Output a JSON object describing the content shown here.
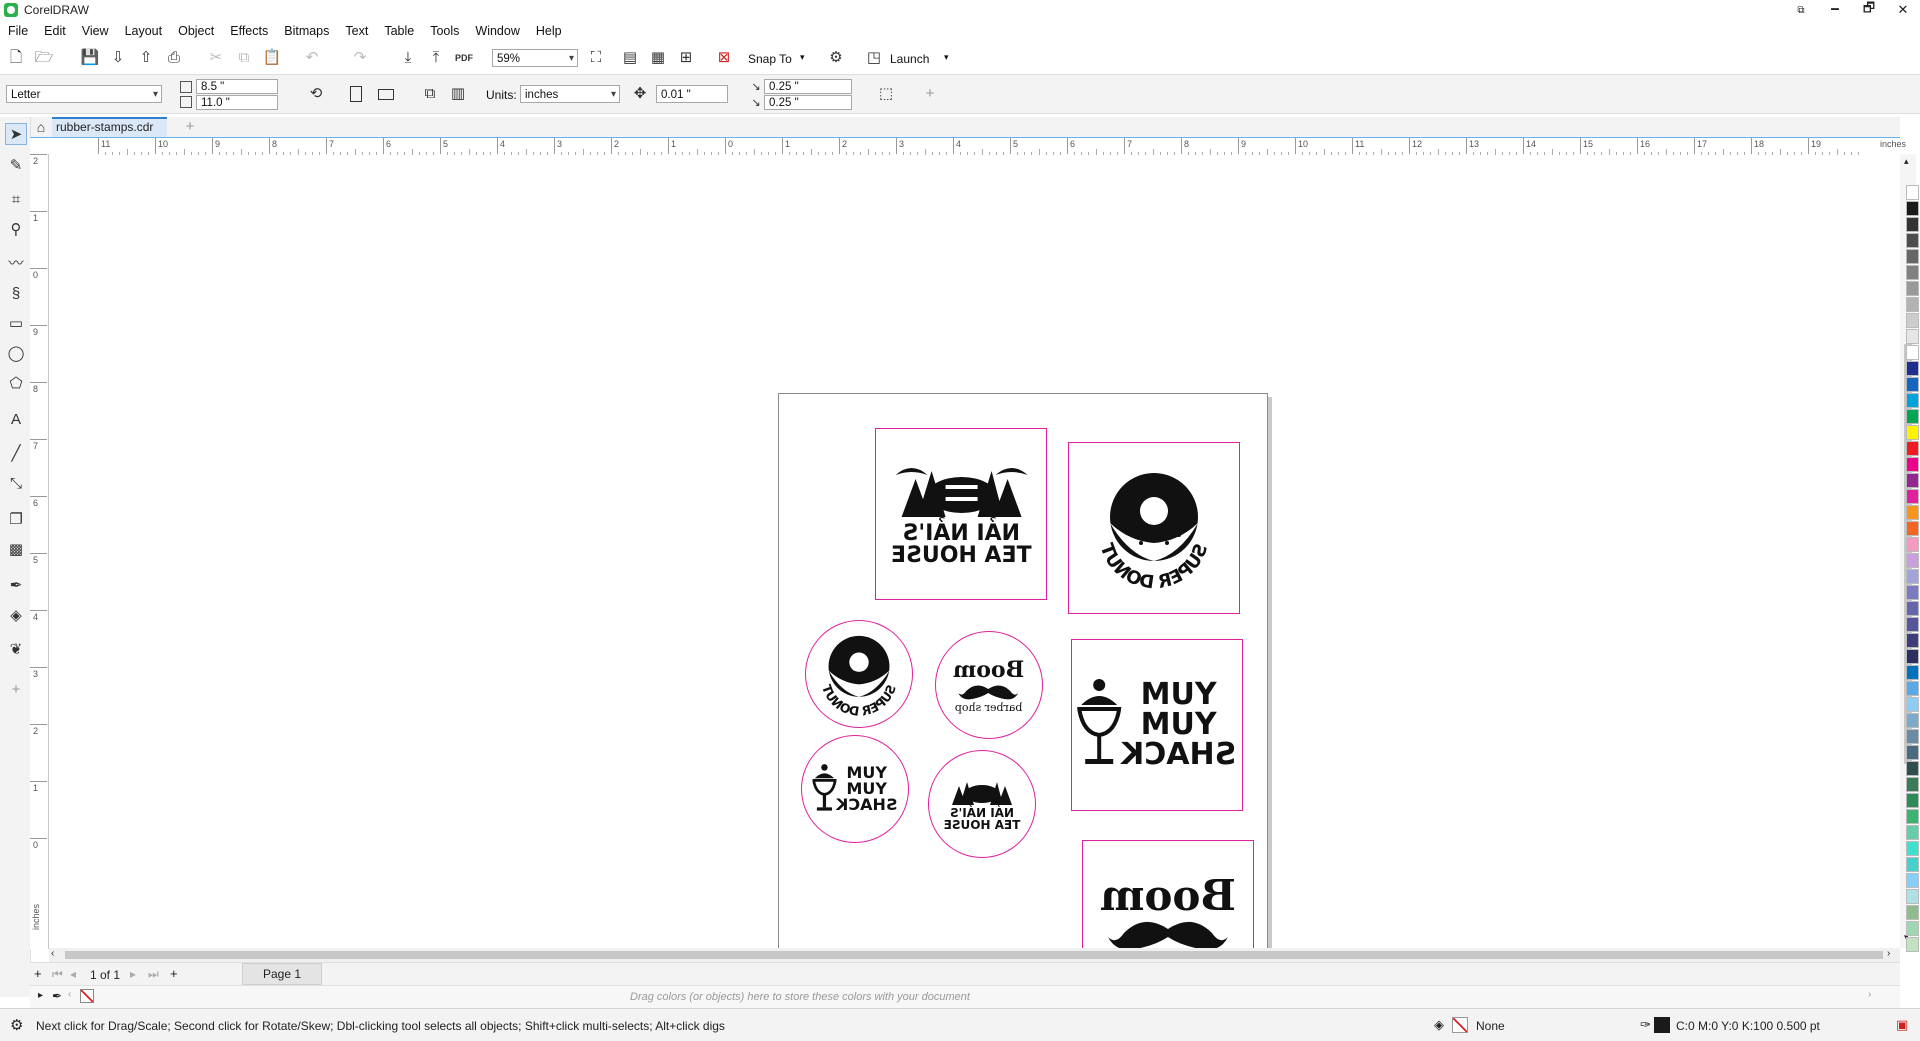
{
  "window": {
    "app_title": "CorelDRAW",
    "controls": [
      "🗕",
      "🗗",
      "✕"
    ]
  },
  "menu": [
    "File",
    "Edit",
    "View",
    "Layout",
    "Object",
    "Effects",
    "Bitmaps",
    "Text",
    "Table",
    "Tools",
    "Window",
    "Help"
  ],
  "toolbar": {
    "zoom": "59%",
    "snap_to": "Snap To",
    "launch": "Launch"
  },
  "property_bar": {
    "paper_size": "Letter",
    "width": "8.5 \"",
    "height": "11.0 \"",
    "units_label": "Units:",
    "units": "inches",
    "nudge": "0.01 \"",
    "dup_x": "0.25 \"",
    "dup_y": "0.25 \""
  },
  "document_tab": {
    "filename": "rubber-stamps.cdr"
  },
  "ruler": {
    "unit": "inches",
    "h_ticks": [
      "11",
      "10",
      "9",
      "8",
      "7",
      "6",
      "5",
      "4",
      "3",
      "2",
      "1",
      "0",
      "1",
      "2",
      "3",
      "4",
      "5",
      "6",
      "7",
      "8",
      "9",
      "10",
      "11",
      "12",
      "13",
      "14",
      "15",
      "16",
      "17",
      "18",
      "19"
    ],
    "v_ticks": [
      "2",
      "1",
      "0",
      "9",
      "8",
      "7",
      "6",
      "5",
      "4",
      "3",
      "2",
      "1",
      "0"
    ],
    "v_unit": "inches"
  },
  "stamps": {
    "nai_line1": "NẢI NẢI'S",
    "nai_line2": "TEA HOUSE",
    "donut_text": "SUPER DONUT",
    "yum1": "YUM",
    "yum2": "YUM",
    "shack": "SHACK",
    "boom": "Boom",
    "barber": "barber shop"
  },
  "page_nav": {
    "counter": "1 of 1",
    "page_tab": "Page 1"
  },
  "color_dock_hint": "Drag colors (or objects) here to store these colors with your document",
  "status": {
    "hint": "Next click for Drag/Scale; Second click for Rotate/Skew; Dbl-clicking tool selects all objects; Shift+click multi-selects; Alt+click digs",
    "fill": "None",
    "outline": "C:0 M:0 Y:0 K:100  0.500 pt"
  },
  "palette_colors": [
    "#ffffff",
    "#1a1a1a",
    "#333333",
    "#4d4d4d",
    "#666666",
    "#808080",
    "#999999",
    "#b3b3b3",
    "#cccccc",
    "#e6e6e6",
    "#ffffff",
    "#1f2f8f",
    "#1565c0",
    "#00a3d9",
    "#00a651",
    "#fff200",
    "#ed1c24",
    "#ec008c",
    "#92278f",
    "#e0219c",
    "#f7941d",
    "#f26522",
    "#f49ac1",
    "#c9a0dc",
    "#a3a3d9",
    "#7b7bc2",
    "#6666aa",
    "#555599",
    "#3d3d7a",
    "#2e2e5e",
    "#0072bc",
    "#5aa9e6",
    "#8ecdf2",
    "#7fa9c9",
    "#6b8ba4",
    "#4a6b7f",
    "#2f4f4f",
    "#3b7a57",
    "#2e8b57",
    "#3cb371",
    "#66cdaa",
    "#40e0d0",
    "#48d1cc",
    "#87cefa",
    "#b0e0e6",
    "#8fbc8f",
    "#a0d6b4",
    "#c1e1c1"
  ]
}
